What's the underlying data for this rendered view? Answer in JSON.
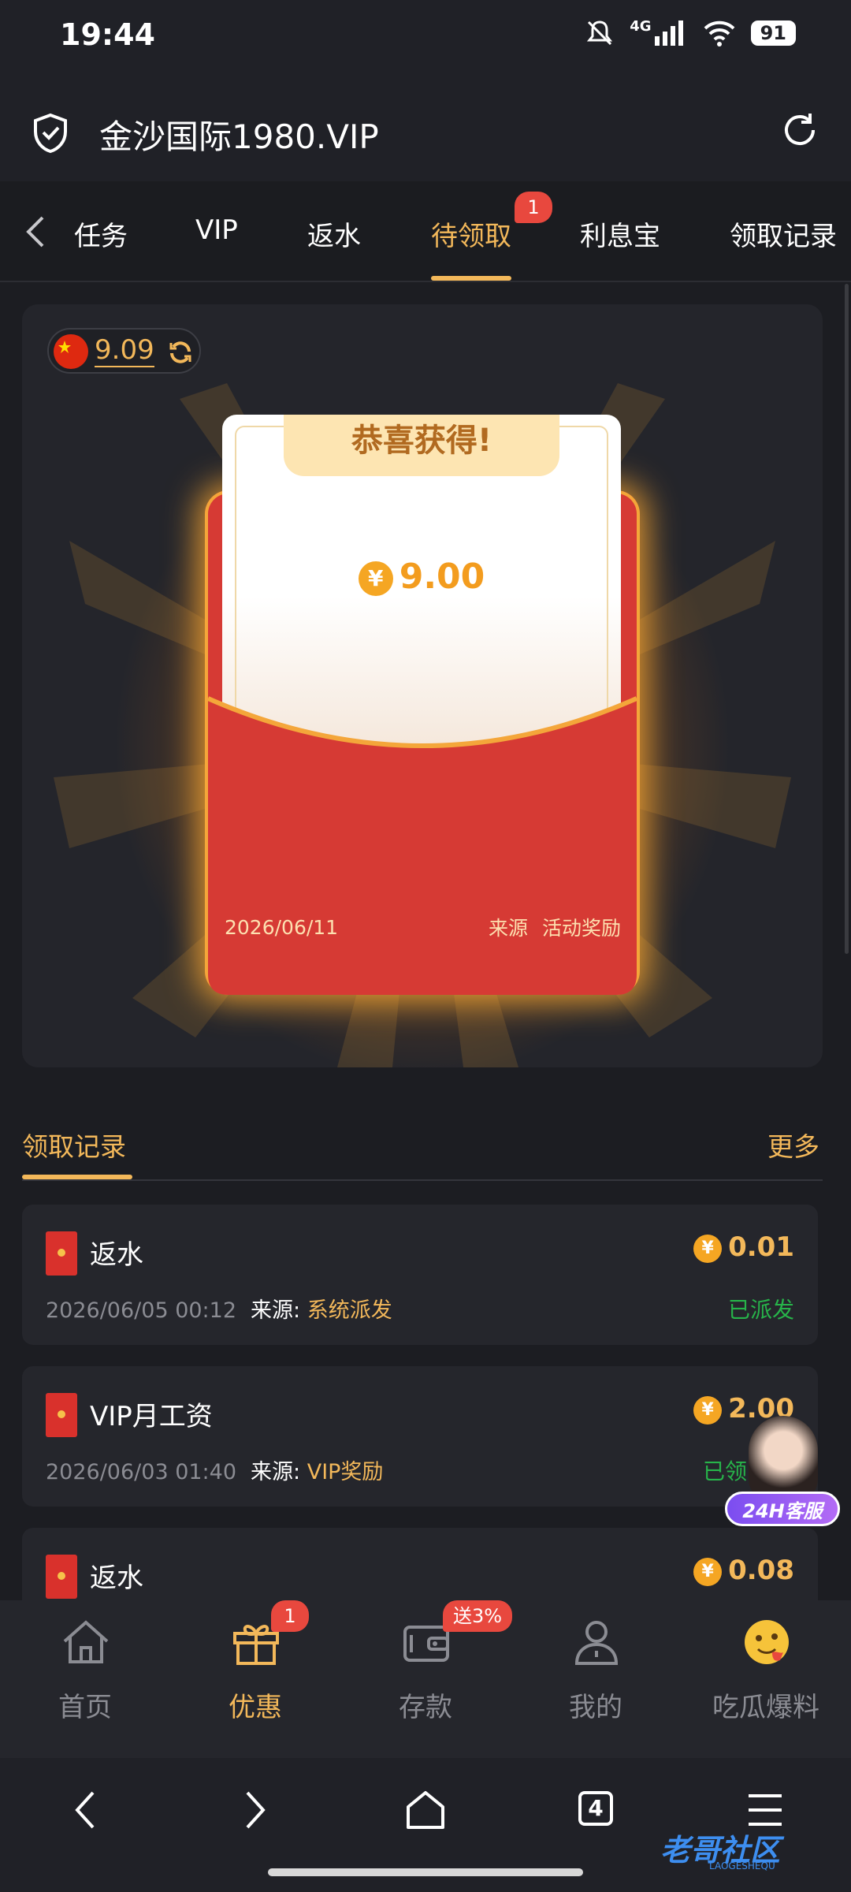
{
  "status_bar": {
    "time": "19:44",
    "network": "4G",
    "battery": "91"
  },
  "browser": {
    "url_title": "金沙国际1980.VIP"
  },
  "tabs": {
    "items": [
      {
        "label": "任务"
      },
      {
        "label": "VIP"
      },
      {
        "label": "返水"
      },
      {
        "label": "待领取"
      },
      {
        "label": "利息宝"
      },
      {
        "label": "领取记录"
      }
    ],
    "active_index": 3,
    "badge": "1"
  },
  "balance": {
    "value": "9.09"
  },
  "red_packet": {
    "title": "恭喜获得!",
    "currency_symbol": "¥",
    "amount": "9.00",
    "date": "2026/06/11",
    "source_label": "来源",
    "source_value": "活动奖励"
  },
  "records": {
    "title": "领取记录",
    "more": "更多",
    "source_prefix": "来源:",
    "items": [
      {
        "name": "返水",
        "time": "2026/06/05 00:12",
        "source": "系统派发",
        "amount": "0.01",
        "status": "已派发"
      },
      {
        "name": "VIP月工资",
        "time": "2026/06/03 01:40",
        "source": "VIP奖励",
        "amount": "2.00",
        "status": "已领"
      },
      {
        "name": "返水",
        "amount": "0.08"
      }
    ]
  },
  "service": {
    "label": "24H客服"
  },
  "bottom_nav": {
    "items": [
      {
        "label": "首页",
        "icon": "home-icon"
      },
      {
        "label": "优惠",
        "icon": "gift-icon"
      },
      {
        "label": "存款",
        "icon": "wallet-icon"
      },
      {
        "label": "我的",
        "icon": "user-icon"
      },
      {
        "label": "吃瓜爆料",
        "icon": "emoji-icon"
      }
    ],
    "active_index": 1,
    "promo_badge": "1",
    "deposit_badge": "送3%"
  },
  "system_nav": {
    "tabs_count": "4"
  },
  "watermark": {
    "text": "老哥社区",
    "sub": "LAOGESHEQU"
  },
  "colors": {
    "accent": "#f3b85a",
    "red": "#d63a34",
    "green": "#27b44a",
    "background": "#1c1d22"
  }
}
